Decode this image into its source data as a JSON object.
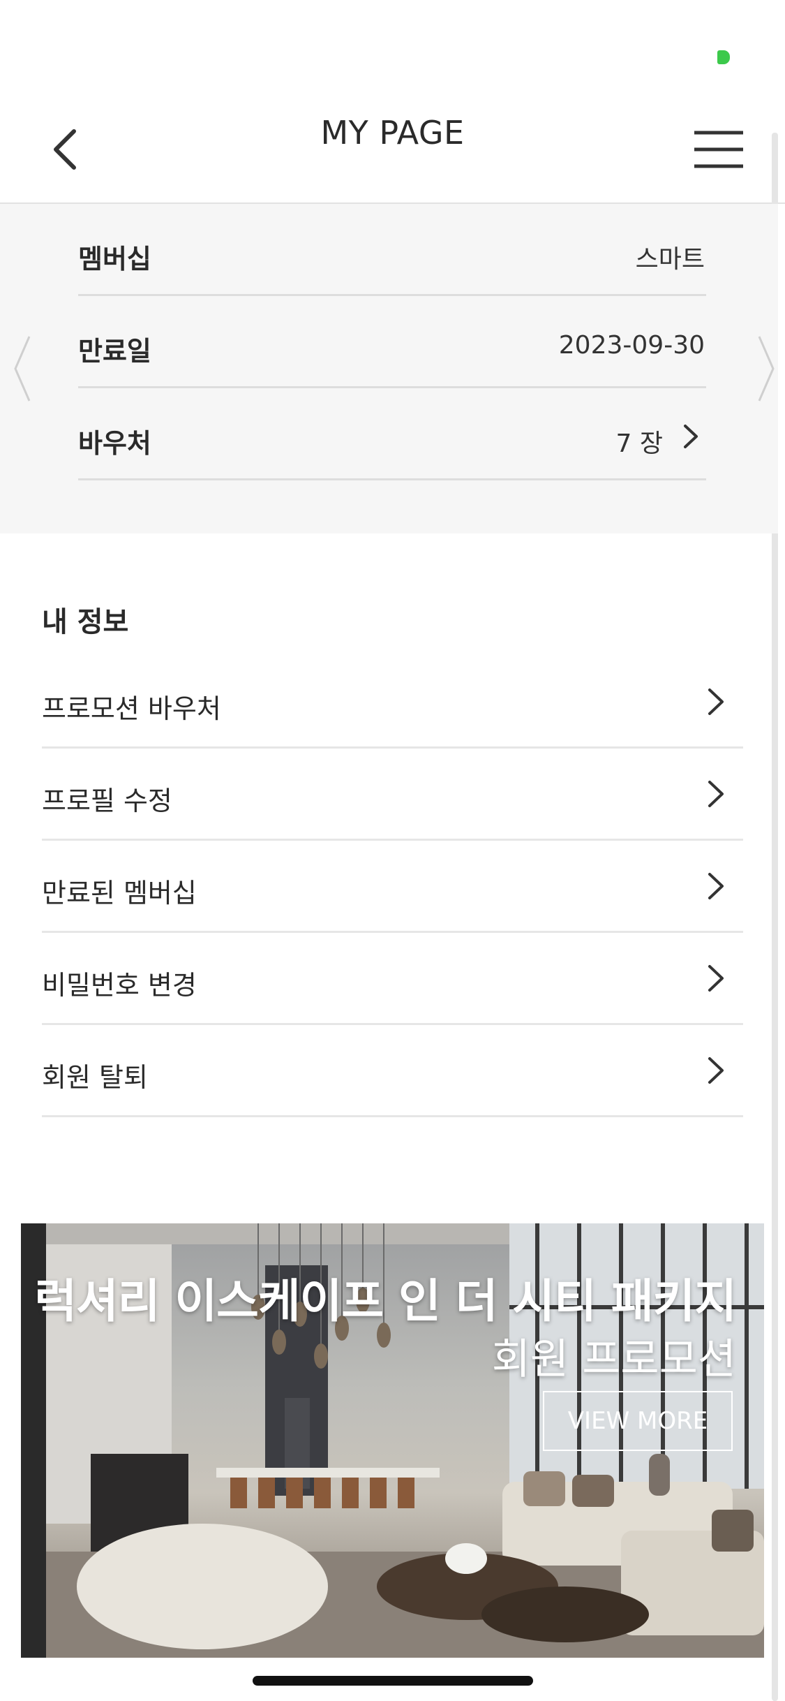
{
  "header": {
    "title": "MY PAGE",
    "back_icon": "chevron-left-icon",
    "menu_icon": "hamburger-menu-icon"
  },
  "membership_card": {
    "rows": [
      {
        "label": "멤버십",
        "value": "스마트"
      },
      {
        "label": "만료일",
        "value": "2023-09-30"
      },
      {
        "label": "바우처",
        "value": "7 장"
      }
    ]
  },
  "my_info": {
    "title": "내 정보",
    "items": [
      {
        "label": "프로모션 바우처"
      },
      {
        "label": "프로필 수정"
      },
      {
        "label": "만료된 멤버십"
      },
      {
        "label": "비밀번호 변경"
      },
      {
        "label": "회원 탈퇴"
      }
    ]
  },
  "promo": {
    "title": "럭셔리 이스케이프 인 더 시티 패키지",
    "subtitle": "회원 프로모션",
    "cta": "VIEW MORE"
  },
  "colors": {
    "card_background": "#f6f6f6",
    "divider": "#dddddd",
    "status_green": "#3cc94b",
    "text_primary": "#2a2a2a"
  }
}
